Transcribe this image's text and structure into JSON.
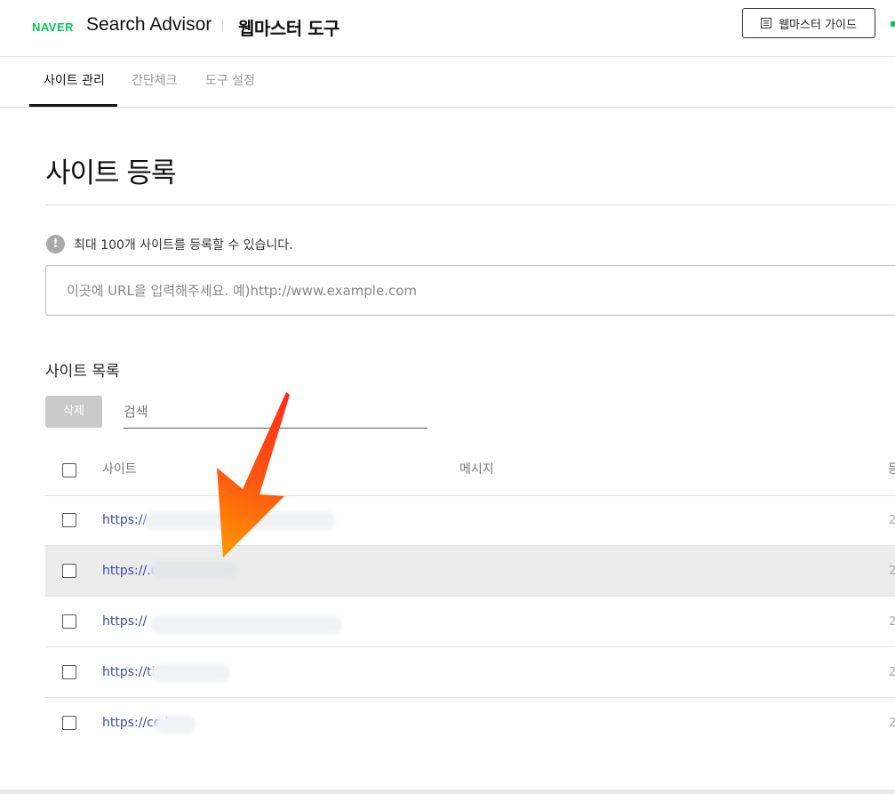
{
  "header": {
    "naver_logo": "NAVER",
    "brand": "Search Advisor",
    "subtitle": "웹마스터 도구",
    "guide_button": "웹마스터 가이드"
  },
  "tabs": [
    {
      "label": "사이트 관리",
      "active": true
    },
    {
      "label": "간단체크",
      "active": false
    },
    {
      "label": "도구 설정",
      "active": false
    }
  ],
  "page": {
    "title": "사이트 등록",
    "info_text": "최대 100개 사이트를 등록할 수 있습니다.",
    "url_placeholder": "이곳에 URL을 입력해주세요. 예)http://www.example.com"
  },
  "site_list": {
    "title": "사이트 목록",
    "delete_label": "삭제",
    "search_placeholder": "검색",
    "columns": [
      "사이트",
      "메시지",
      "등"
    ],
    "rows": [
      {
        "url": "https://",
        "date": "2"
      },
      {
        "url": "https://.co.kr",
        "date": "2"
      },
      {
        "url": "https://",
        "date": "2"
      },
      {
        "url": "https://tistory.com",
        "date": "2"
      },
      {
        "url": "https://co.kr",
        "date": "2"
      }
    ]
  },
  "colors": {
    "brand_green": "#03c75a",
    "link_blue": "#3b49a8",
    "arrow_orange": "#ff8a00",
    "arrow_red": "#ff2a1a"
  }
}
